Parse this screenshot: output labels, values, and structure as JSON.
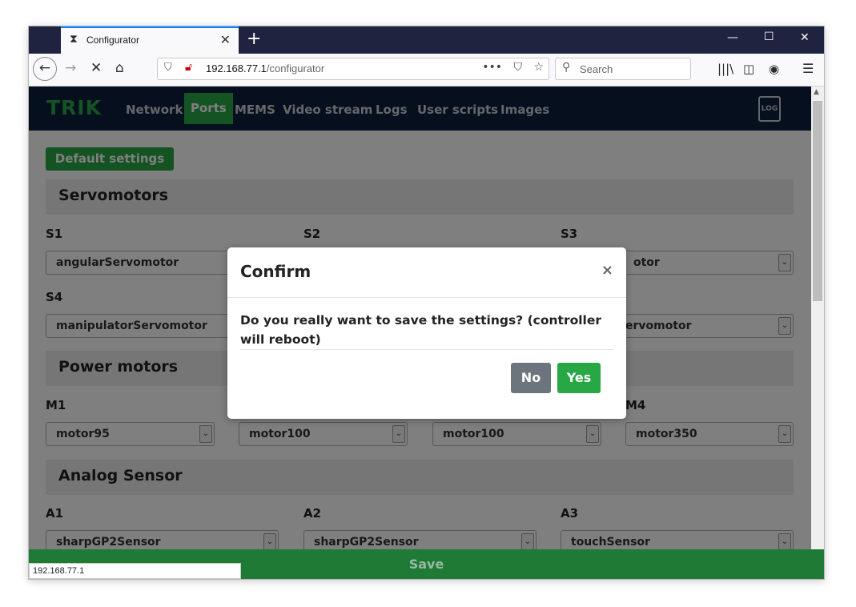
{
  "browser": {
    "tab_title": "Configurator",
    "tab_icon": "hourglass-icon",
    "url_host": "192.168.77.1",
    "url_path": "/configurator",
    "search_placeholder": "Search",
    "status_url": "192.168.77.1"
  },
  "navbar": {
    "brand": "TRIK",
    "items": [
      "Network",
      "Ports",
      "MEMS",
      "Video stream",
      "Logs",
      "User scripts",
      "Images"
    ],
    "active": "Ports",
    "log_icon_label": "LOG"
  },
  "page": {
    "default_button": "Default settings",
    "sections": {
      "servo": "Servomotors",
      "power": "Power motors",
      "analog": "Analog Sensor"
    },
    "servo_ports": {
      "s1": {
        "label": "S1",
        "value": "angularServomotor"
      },
      "s2": {
        "label": "S2"
      },
      "s3": {
        "label": "S3",
        "value": "otor"
      },
      "s4": {
        "label": "S4",
        "value": "manipulatorServomotor"
      },
      "s6": {
        "value": "ervomotor"
      }
    },
    "power_ports": {
      "m1": {
        "label": "M1",
        "value": "motor95"
      },
      "m2": {
        "value": "motor100"
      },
      "m3": {
        "value": "motor100"
      },
      "m4": {
        "label": "M4",
        "value": "motor350"
      }
    },
    "analog_ports": {
      "a1": {
        "label": "A1",
        "value": "sharpGP2Sensor"
      },
      "a2": {
        "label": "A2",
        "value": "sharpGP2Sensor"
      },
      "a3": {
        "label": "A3",
        "value": "touchSensor"
      }
    },
    "save_label": "Save"
  },
  "modal": {
    "title": "Confirm",
    "close": "×",
    "body": "Do you really want to save the settings? (controller will reboot)",
    "no": "No",
    "yes": "Yes"
  },
  "colors": {
    "accent": "#28a745",
    "navbar": "#0a1f3d",
    "secondary": "#6c757d"
  }
}
